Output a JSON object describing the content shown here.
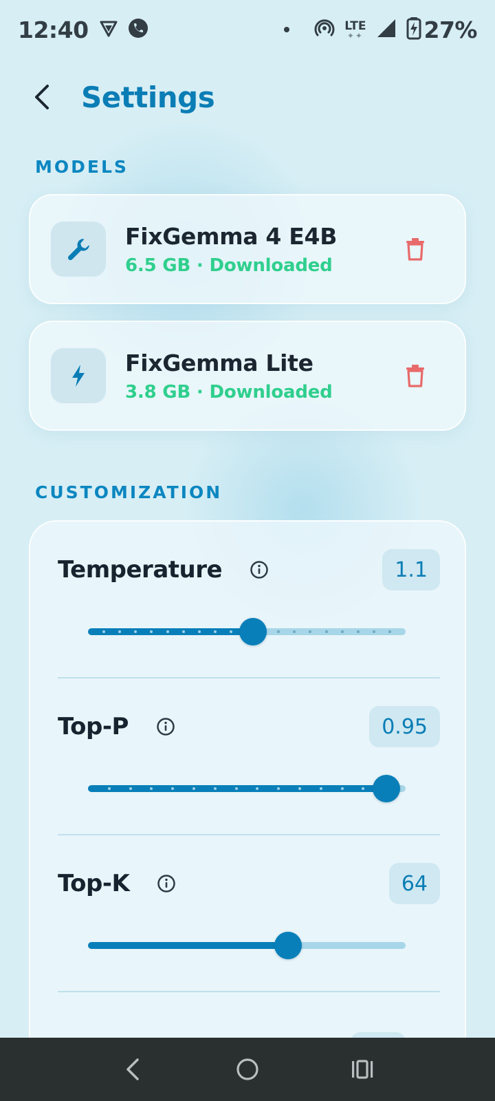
{
  "status_bar": {
    "time": "12:40",
    "battery": "27%",
    "network": "LTE",
    "icons": [
      "vpn-shield-icon",
      "whatsapp-icon",
      "notification-dot-icon",
      "hotspot-icon",
      "lte-icon",
      "signal-icon",
      "battery-charging-icon"
    ]
  },
  "header": {
    "title": "Settings",
    "back_icon": "chevron-left-icon"
  },
  "sections": {
    "models": "MODELS",
    "customization": "CUSTOMIZATION"
  },
  "models": [
    {
      "name": "FixGemma 4 E4B",
      "meta": "6.5 GB · Downloaded",
      "icon": "wrench-icon"
    },
    {
      "name": "FixGemma Lite",
      "meta": "3.8 GB · Downloaded",
      "icon": "lightning-icon"
    }
  ],
  "params": [
    {
      "label": "Temperature",
      "value": "1.1",
      "position": 0.52,
      "steps": 20
    },
    {
      "label": "Top-P",
      "value": "0.95",
      "position": 0.94,
      "steps": 15
    },
    {
      "label": "Top-K",
      "value": "64",
      "position": 0.63,
      "steps": 0
    }
  ],
  "colors": {
    "accent": "#0a7db5",
    "downloaded": "#2fcf8d",
    "delete": "#e86a6a",
    "background": "#d7eef5"
  },
  "nav": {
    "icons": [
      "back-nav-icon",
      "home-nav-icon",
      "recents-nav-icon"
    ]
  }
}
